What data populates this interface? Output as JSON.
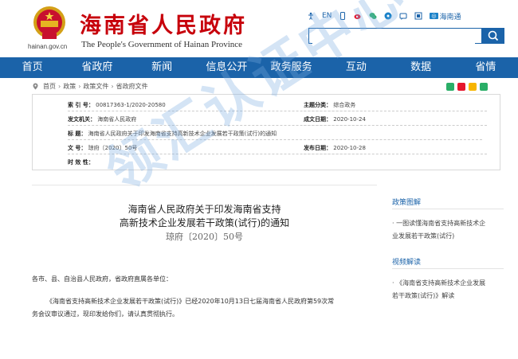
{
  "header": {
    "domain": "hainan.gov.cn",
    "title": "海南省人民政府",
    "subtitle": "The People's Government of Hainan Province",
    "tools": {
      "en": "EN",
      "hainan_tong": "海南通"
    },
    "search": {
      "value": "",
      "placeholder": ""
    }
  },
  "nav": [
    "首页",
    "省政府",
    "新闻",
    "信息公开",
    "政务服务",
    "互动",
    "数据",
    "省情"
  ],
  "breadcrumb": [
    "首页",
    "政策",
    "政策文件",
    "省政府文件"
  ],
  "info": {
    "labels": {
      "index": "索  引  号：",
      "publisher": "发文机关：",
      "title": "标    题：",
      "doc_no": "文    号：",
      "validity": "时  效  性：",
      "category": "主题分类：",
      "date_written": "成文日期：",
      "date_published": "发布日期："
    },
    "values": {
      "index": "00817363-1/2020-20580",
      "publisher": "海南省人民政府",
      "title": "海南省人民政府关于印发海南省支持高新技术企业发展若干政策(试行)的通知",
      "doc_no": "琼府〔2020〕50号",
      "validity": "",
      "category": "综合政务",
      "date_written": "2020-10-24",
      "date_published": "2020-10-28"
    }
  },
  "article": {
    "title_line1": "海南省人民政府关于印发海南省支持",
    "title_line2": "高新技术企业发展若干政策(试行)的通知",
    "doc_number": "琼府〔2020〕50号",
    "salutation": "各市、县、自治县人民政府，省政府直属各单位：",
    "para_line1": "《海南省支持高新技术企业发展若干政策(试行)》已经2020年10月13日七届海南省人民政府第59次常",
    "para_line2": "务会议审议通过，现印发给你们，请认真贯彻执行。"
  },
  "sidebar": {
    "section1": "政策图解",
    "item1_line1": "· 一图读懂海南省支持高新技术企",
    "item1_line2": "业发展若干政策(试行)",
    "section2": "视频解读",
    "item2_line1": "· 《海南省支持高新技术企业发展",
    "item2_line2": "若干政策(试行)》解读"
  },
  "watermark": "领汇认证中心",
  "colors": {
    "brand_red": "#c7000b",
    "nav_blue": "#1b63a9"
  },
  "icons": [
    "wechat-icon",
    "weibo-icon",
    "wechat-chat-icon",
    "app-icon",
    "accessibility-icon",
    "mobile-icon",
    "hainan-tong-icon",
    "search-icon"
  ]
}
